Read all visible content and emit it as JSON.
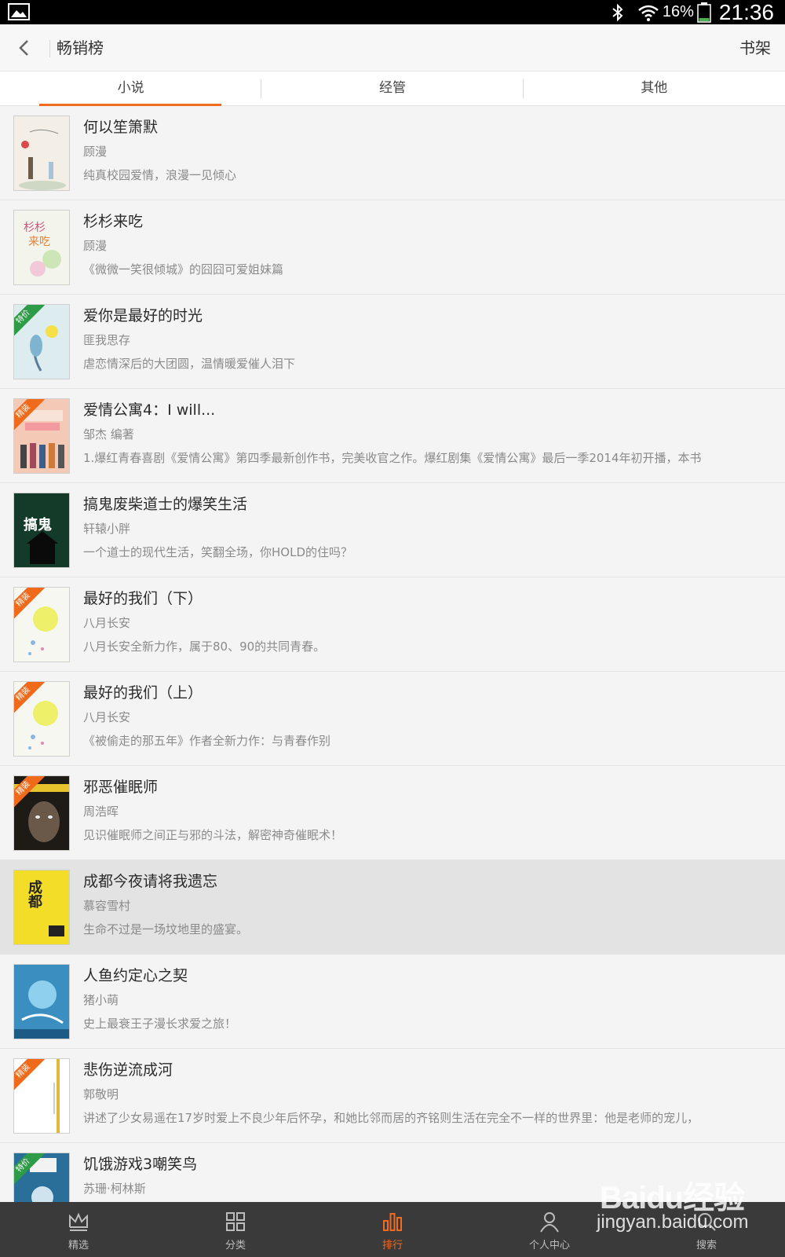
{
  "status_bar": {
    "battery": "16%",
    "time": "21:36"
  },
  "header": {
    "title": "畅销榜",
    "bookshelf": "书架"
  },
  "tabs": [
    {
      "label": "小说",
      "active": true
    },
    {
      "label": "经管",
      "active": false
    },
    {
      "label": "其他",
      "active": false
    }
  ],
  "books": [
    {
      "title": "何以笙箫默",
      "author": "顾漫",
      "desc": "纯真校园爱情，浪漫一见倾心",
      "badge": "",
      "cover_color": "#f3efe6"
    },
    {
      "title": "杉杉来吃",
      "author": "顾漫",
      "desc": "《微微一笑很倾城》的囧囧可爱姐妹篇",
      "badge": "",
      "cover_color": "#f3f5ec"
    },
    {
      "title": "爱你是最好的时光",
      "author": "匪我思存",
      "desc": "虐恋情深后的大团圆，温情暖爱催人泪下",
      "badge": "特价",
      "cover_color": "#dcecef"
    },
    {
      "title": "爱情公寓4：I will...",
      "author": "邹杰 编著",
      "desc": "1.爆红青春喜剧《爱情公寓》第四季最新创作书，完美收官之作。爆红剧集《爱情公寓》最后一季2014年初开播，本书",
      "badge": "精装",
      "cover_color": "#f4c9b6"
    },
    {
      "title": "搞鬼废柴道士的爆笑生活",
      "author": "轩辕小胖",
      "desc": "一个道士的现代生活，笑翻全场，你HOLD的住吗？",
      "badge": "",
      "cover_color": "#143a2a"
    },
    {
      "title": "最好的我们（下）",
      "author": "八月长安",
      "desc": "八月长安全新力作，属于80、90的共同青春。",
      "badge": "精装",
      "cover_color": "#f7f7f2"
    },
    {
      "title": "最好的我们（上）",
      "author": "八月长安",
      "desc": "《被偷走的那五年》作者全新力作：与青春作别",
      "badge": "精装",
      "cover_color": "#f7f7f2"
    },
    {
      "title": "邪恶催眠师",
      "author": "周浩晖",
      "desc": "见识催眠师之间正与邪的斗法，解密神奇催眠术！",
      "badge": "精装",
      "cover_color": "#1e1a16"
    },
    {
      "title": "成都今夜请将我遗忘",
      "author": "慕容雪村",
      "desc": "生命不过是一场坟地里的盛宴。",
      "badge": "",
      "cover_color": "#f4dd28"
    },
    {
      "title": "人鱼约定心之契",
      "author": "猪小萌",
      "desc": "史上最衰王子漫长求爱之旅！",
      "badge": "",
      "cover_color": "#3b8ec0"
    },
    {
      "title": "悲伤逆流成河",
      "author": "郭敬明",
      "desc": "讲述了少女易遥在17岁时爱上不良少年后怀孕，和她比邻而居的齐铭则生活在完全不一样的世界里：他是老师的宠儿，",
      "badge": "精装",
      "cover_color": "#ffffff"
    },
    {
      "title": "饥饿游戏3嘲笑鸟",
      "author": "苏珊·柯林斯",
      "desc": "",
      "badge": "特价",
      "cover_color": "#2a6f99"
    }
  ],
  "covers": {
    "c4_text": "搞鬼",
    "c8_text": "成都"
  },
  "bottom_nav": [
    {
      "label": "精选",
      "icon": "crown-icon",
      "active": false
    },
    {
      "label": "分类",
      "icon": "grid-icon",
      "active": false
    },
    {
      "label": "排行",
      "icon": "bar-chart-icon",
      "active": true
    },
    {
      "label": "个人中心",
      "icon": "user-icon",
      "active": false
    },
    {
      "label": "搜索",
      "icon": "search-icon",
      "active": false
    }
  ],
  "watermark": {
    "main": "Baidu经验",
    "sub": "jingyan.baidu.com"
  },
  "colors": {
    "accent": "#f06c1f",
    "nav_bg": "#3a3a3a",
    "highlight_row": "#e3e3e3"
  }
}
